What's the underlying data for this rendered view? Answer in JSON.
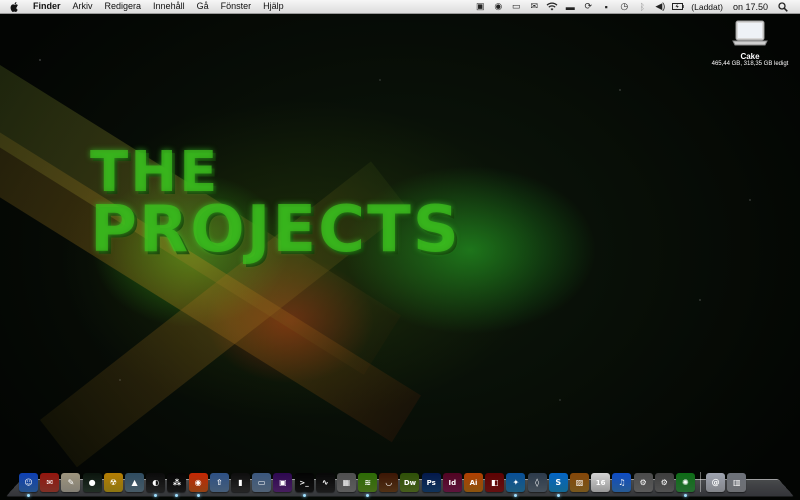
{
  "menubar": {
    "apple_icon": "apple-logo-icon",
    "app_name": "Finder",
    "menus": [
      "Arkiv",
      "Redigera",
      "Innehåll",
      "Gå",
      "Fönster",
      "Hjälp"
    ],
    "battery_status": "(Laddat)",
    "clock": "on 17.50",
    "status_icons": [
      "timemachine-icon",
      "webcam-icon",
      "screen-icon",
      "mail-icon",
      "wifi-icon",
      "display-icon",
      "sync-icon",
      "script-icon",
      "clock-icon",
      "bluetooth-icon",
      "volume-icon",
      "battery-icon",
      "spotlight-icon"
    ]
  },
  "desktop": {
    "wallpaper_text": [
      "THE",
      "PROJECTS"
    ],
    "disk": {
      "name": "Cake",
      "info": "465,44 GB, 318,35 GB ledigt"
    }
  },
  "dock": {
    "apps": [
      {
        "name": "Finder",
        "icon": "finder-icon",
        "color": "#3b7fd6",
        "glyph": "☺"
      },
      {
        "name": "Mail",
        "icon": "mail-icon",
        "color": "#c24a3b",
        "glyph": "✉"
      },
      {
        "name": "Preview",
        "icon": "preview-icon",
        "color": "#c9c3b3",
        "glyph": "✎"
      },
      {
        "name": "Adium",
        "icon": "adium-icon",
        "color": "#34483a",
        "glyph": "●"
      },
      {
        "name": "Radioactive",
        "icon": "radioactive-icon",
        "color": "#d7b31b",
        "glyph": "☢"
      },
      {
        "name": "Transmit",
        "icon": "transmit-icon",
        "color": "#6d8b9d",
        "glyph": "▲"
      },
      {
        "name": "Cyberduck",
        "icon": "cyberduck-icon",
        "color": "#333333",
        "glyph": "◐"
      },
      {
        "name": "BlackBerry",
        "icon": "blackberry-icon",
        "color": "#222222",
        "glyph": "⁂"
      },
      {
        "name": "Firefox",
        "icon": "firefox-icon",
        "color": "#e0641e",
        "glyph": "◉"
      },
      {
        "name": "Fetch",
        "icon": "upload-icon",
        "color": "#6b8fb8",
        "glyph": "⇧"
      },
      {
        "name": "Growl",
        "icon": "growl-icon",
        "color": "#3a3a3a",
        "glyph": "▮"
      },
      {
        "name": "Screen Sharing",
        "icon": "monitor-icon",
        "color": "#7a95b3",
        "glyph": "▭"
      },
      {
        "name": "Front Row",
        "icon": "frontrow-icon",
        "color": "#6b2d8f",
        "glyph": "▣"
      },
      {
        "name": "Terminal",
        "icon": "terminal-icon",
        "color": "#1b1b1b",
        "glyph": ">_"
      },
      {
        "name": "Activity Monitor",
        "icon": "activity-monitor-icon",
        "color": "#2a2a2a",
        "glyph": "∿"
      },
      {
        "name": "Calculator",
        "icon": "calculator-icon",
        "color": "#8e8e8e",
        "glyph": "▦"
      },
      {
        "name": "Spotify",
        "icon": "spotify-icon",
        "color": "#6aa525",
        "glyph": "≋"
      },
      {
        "name": "Coffee",
        "icon": "coffee-icon",
        "color": "#7b4b21",
        "glyph": "◡"
      },
      {
        "name": "Dreamweaver",
        "icon": "dreamweaver-icon",
        "color": "#6c8f2b",
        "glyph": "Dw"
      },
      {
        "name": "Photoshop",
        "icon": "photoshop-icon",
        "color": "#1b4f8a",
        "glyph": "Ps"
      },
      {
        "name": "InDesign",
        "icon": "indesign-icon",
        "color": "#8f1f5c",
        "glyph": "Id"
      },
      {
        "name": "Illustrator",
        "icon": "illustrator-icon",
        "color": "#d47f14",
        "glyph": "Ai"
      },
      {
        "name": "Flashlight",
        "icon": "flashlight-icon",
        "color": "#9a1a1a",
        "glyph": "◧"
      },
      {
        "name": "Safari",
        "icon": "safari-icon",
        "color": "#2d8ec4",
        "glyph": "✦"
      },
      {
        "name": "Xcode",
        "icon": "xcode-icon",
        "color": "#6a7a8a",
        "glyph": "◊"
      },
      {
        "name": "Skype",
        "icon": "skype-icon",
        "color": "#1ea0e0",
        "glyph": "S"
      },
      {
        "name": "iPhoto",
        "icon": "photo-icon",
        "color": "#b8862d",
        "glyph": "▨"
      },
      {
        "name": "iCal",
        "icon": "calendar-icon",
        "color": "#e8e8e8",
        "glyph": "16"
      },
      {
        "name": "iTunes",
        "icon": "itunes-icon",
        "color": "#3c8be0",
        "glyph": "♫"
      },
      {
        "name": "Utility",
        "icon": "utility-icon",
        "color": "#8a8a8a",
        "glyph": "⚙"
      },
      {
        "name": "System Preferences",
        "icon": "system-preferences-icon",
        "color": "#7d7d7d",
        "glyph": "⚙"
      },
      {
        "name": "Pinwheel",
        "icon": "pinwheel-icon",
        "color": "#3aa64a",
        "glyph": "✺"
      }
    ],
    "docs": [
      {
        "name": "Documents",
        "icon": "documents-icon",
        "color": "#c9ccd4",
        "glyph": "@"
      },
      {
        "name": "Trash",
        "icon": "trash-icon",
        "color": "#a7aab0",
        "glyph": "▥"
      }
    ]
  },
  "colors": {
    "menubar_bg": "#e6e6e6",
    "accent_green": "#3cbe1e"
  }
}
